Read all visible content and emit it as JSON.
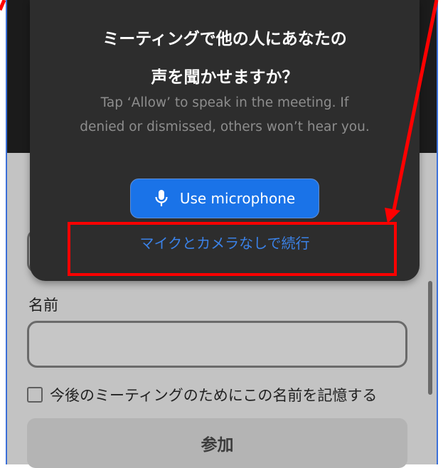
{
  "dialog": {
    "title_line1": "ミーティングで他の人にあなたの",
    "title_line2": "声を聞かせますか？",
    "body": "Tap ‘Allow’ to speak in the meeting. If denied or dismissed, others won’t hear you.",
    "mic_button_label": "Use microphone",
    "continue_link": "マイクとカメラなしで続行"
  },
  "form": {
    "name_label": "名前",
    "name_value": "",
    "remember_label": "今後のミーティングのためにこの名前を記憶する",
    "remember_checked": false,
    "join_button_label": "参加"
  },
  "icons": {
    "mic": "microphone-icon",
    "checkbox": "checkbox-icon"
  },
  "colors": {
    "dialog_bg": "#2d2d2d",
    "primary_blue": "#1a73e8",
    "link_blue": "#3b82e8",
    "annotation_red": "#ff0000",
    "overlay_gray": "#c3c3c3"
  }
}
